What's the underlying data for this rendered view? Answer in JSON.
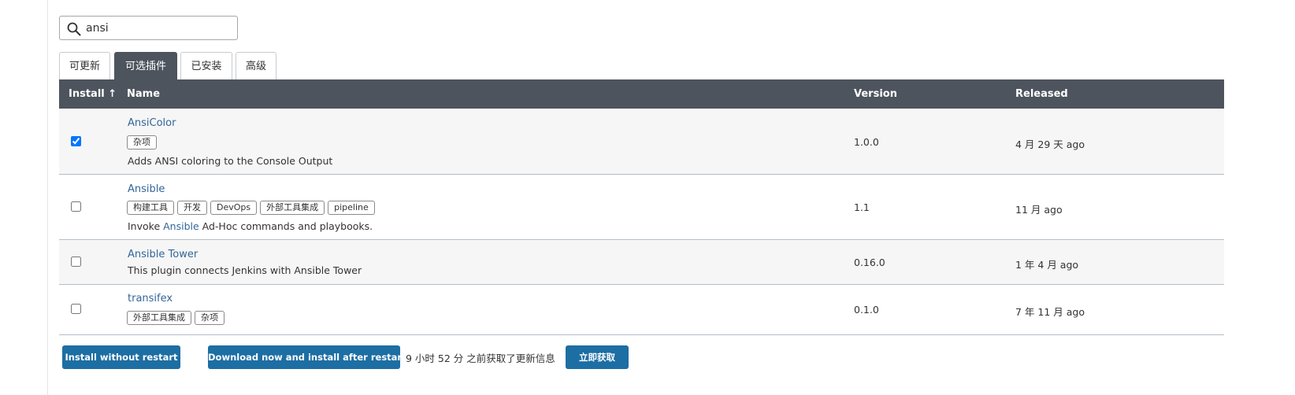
{
  "search": {
    "value": "ansi",
    "placeholder": ""
  },
  "tabs": [
    {
      "label": "可更新",
      "active": false
    },
    {
      "label": "可选插件",
      "active": true
    },
    {
      "label": "已安装",
      "active": false
    },
    {
      "label": "高级",
      "active": false
    }
  ],
  "table": {
    "headers": {
      "install": "Install ↑",
      "name": "Name",
      "version": "Version",
      "released": "Released"
    },
    "rows": [
      {
        "checked": true,
        "name": "AnsiColor",
        "tags": [
          "杂项"
        ],
        "excerpt_pre": "Adds ANSI coloring to the Console Output",
        "excerpt_link": "",
        "excerpt_post": "",
        "version": "1.0.0",
        "released": "4 月 29 天 ago"
      },
      {
        "checked": false,
        "name": "Ansible",
        "tags": [
          "构建工具",
          "开发",
          "DevOps",
          "外部工具集成",
          "pipeline"
        ],
        "excerpt_pre": "Invoke ",
        "excerpt_link": "Ansible",
        "excerpt_post": " Ad-Hoc commands and playbooks.",
        "version": "1.1",
        "released": "11 月 ago"
      },
      {
        "checked": false,
        "name": "Ansible Tower",
        "tags": [],
        "excerpt_pre": "This plugin connects Jenkins with Ansible Tower",
        "excerpt_link": "",
        "excerpt_post": "",
        "version": "0.16.0",
        "released": "1 年 4 月 ago"
      },
      {
        "checked": false,
        "name": "transifex",
        "tags": [
          "外部工具集成",
          "杂项"
        ],
        "excerpt_pre": "",
        "excerpt_link": "",
        "excerpt_post": "",
        "version": "0.1.0",
        "released": "7 年 11 月 ago"
      }
    ]
  },
  "footer": {
    "install_without_restart": "Install without restart",
    "download_install_after_restart": "Download now and install after restart",
    "update_info": "9 小时 52 分 之前获取了更新信息",
    "check_now": "立即获取"
  },
  "colors": {
    "header_bg": "#4d545d",
    "button_bg": "#1d6ea3",
    "link": "#336699"
  }
}
